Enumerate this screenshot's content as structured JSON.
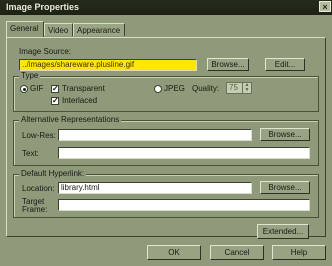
{
  "window": {
    "title": "Image Properties",
    "close_glyph": "×"
  },
  "tabs": [
    {
      "label": "General",
      "active": true
    },
    {
      "label": "Video",
      "active": false
    },
    {
      "label": "Appearance",
      "active": false
    }
  ],
  "image_source": {
    "label": "Image Source:",
    "value": "../images/shareware.plusline.gif",
    "browse_label": "Browse...",
    "edit_label": "Edit..."
  },
  "type_group": {
    "title": "Type",
    "gif_label": "GIF",
    "gif_selected": true,
    "transparent_label": "Transparent",
    "transparent_checked": true,
    "interlaced_label": "Interlaced",
    "interlaced_checked": true,
    "check_glyph": "✓",
    "jpeg_label": "JPEG",
    "jpeg_selected": false,
    "quality_label": "Quality:",
    "quality_value": "75",
    "spin_up": "▲",
    "spin_down": "▼"
  },
  "alt_group": {
    "title": "Alternative Representations",
    "lowres_label": "Low-Res:",
    "lowres_value": "",
    "text_label": "Text:",
    "text_value": "",
    "browse_label": "Browse..."
  },
  "hyperlink_group": {
    "title": "Default Hyperlink:",
    "location_label": "Location:",
    "location_value": "library.html",
    "browse_label": "Browse...",
    "target_label_1": "Target",
    "target_label_2": "Frame:",
    "target_value": ""
  },
  "extended_label": "Extended...",
  "footer": {
    "ok_label": "OK",
    "cancel_label": "Cancel",
    "help_label": "Help"
  }
}
